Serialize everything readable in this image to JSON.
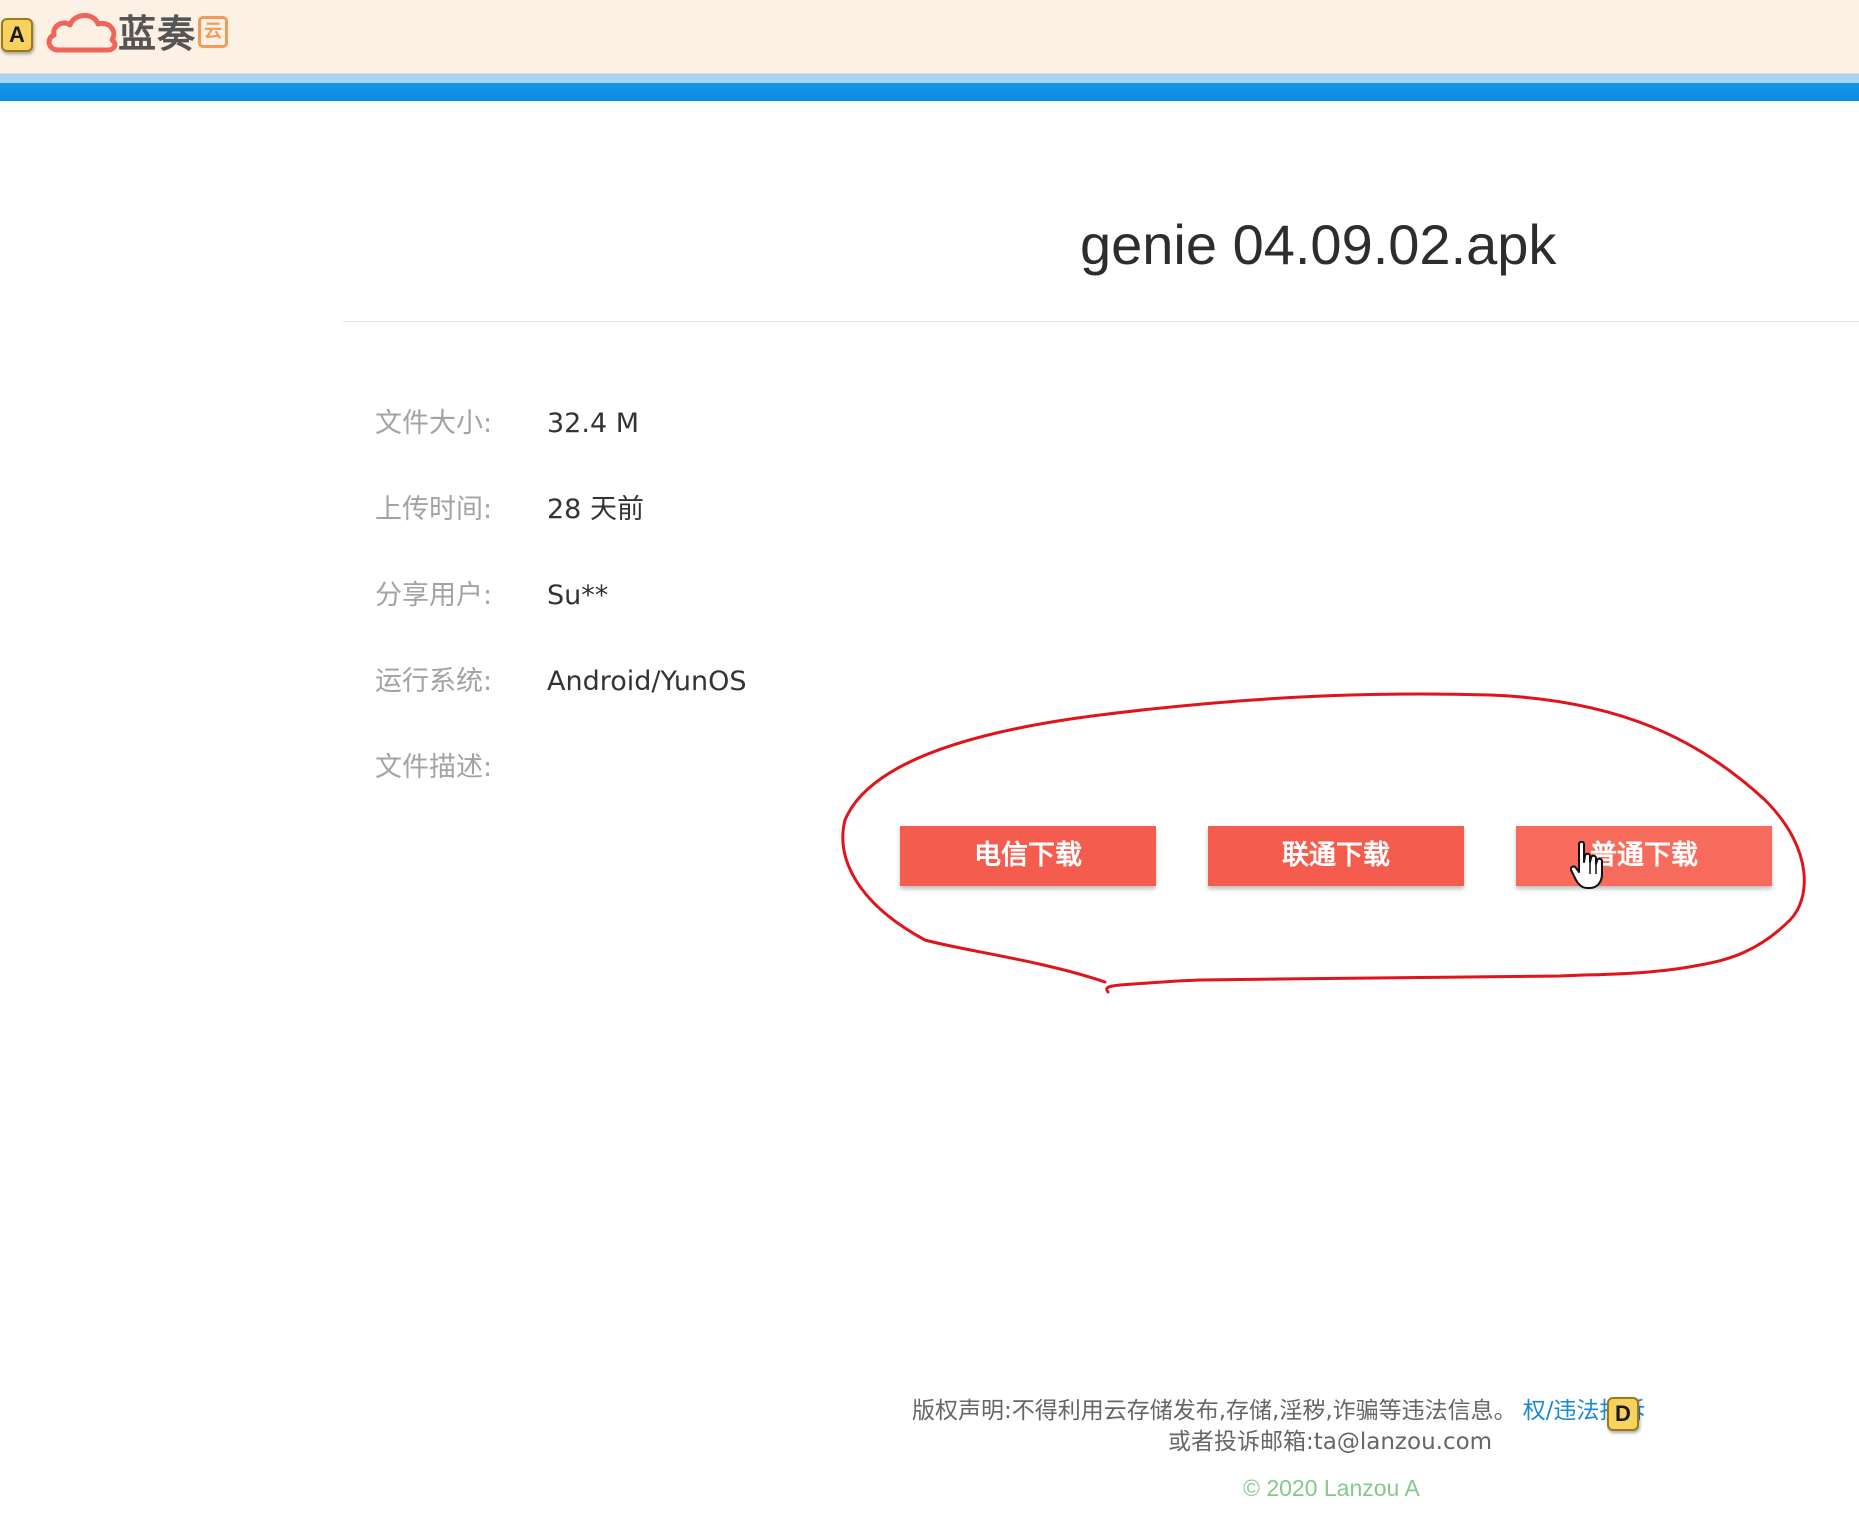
{
  "hints": {
    "logo_hint": "A",
    "footer_hint": "D"
  },
  "header": {
    "logo_text": "蓝奏",
    "logo_badge": "云"
  },
  "file": {
    "title": "genie 04.09.02.apk",
    "info": [
      {
        "label": "文件大小:",
        "value": "32.4 M"
      },
      {
        "label": "上传时间:",
        "value": "28 天前"
      },
      {
        "label": "分享用户:",
        "value": "Su**"
      },
      {
        "label": "运行系统:",
        "value": "Android/YunOS"
      },
      {
        "label": "文件描述:",
        "value": ""
      }
    ]
  },
  "downloads": {
    "telecom": "电信下载",
    "unicom": "联通下载",
    "normal": "普通下载"
  },
  "footer": {
    "notice": "版权声明:不得利用云存储发布,存储,淫秽,诈骗等违法信息。",
    "complaint_link": "权/违法投诉",
    "email_line": "或者投诉邮箱:ta@lanzou.com",
    "copyright": "© 2020 Lanzou A"
  },
  "colors": {
    "header_bg": "#fdf0e4",
    "accent_blue": "#0c8ae3",
    "button_red": "#f45c4d",
    "annotation_red": "#e0141b",
    "copyright_green": "#84c98a"
  },
  "icons": {
    "logo": "cloud-icon",
    "cursor": "hand-pointer-icon"
  }
}
